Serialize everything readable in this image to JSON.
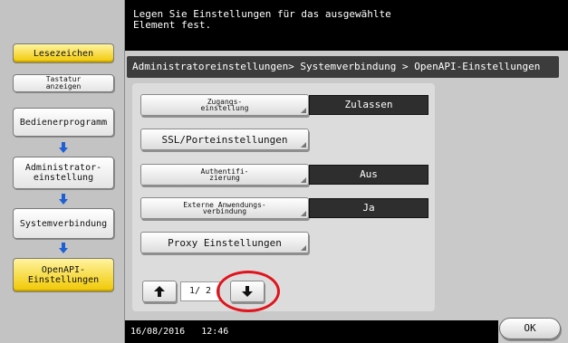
{
  "sidebar": {
    "bookmark_label": "Lesezeichen",
    "keyboard_label": "Tastatur\nanzeigen",
    "items": [
      {
        "label": "Bedienerprogramm"
      },
      {
        "label": "Administrator-\neinstellung"
      },
      {
        "label": "Systemverbindung"
      },
      {
        "label": "OpenAPI-\nEinstellungen"
      }
    ]
  },
  "top_message": "Legen Sie Einstellungen für das ausgewählte\nElement fest.",
  "breadcrumb": "Administratoreinstellungen> Systemverbindung > OpenAPI-Einstellungen",
  "settings": [
    {
      "label": "Zugangs-\neinstellung",
      "value": "Zulassen"
    },
    {
      "label": "SSL/Porteinstellungen",
      "value": ""
    },
    {
      "label": "Authentifi-\nzierung",
      "value": "Aus"
    },
    {
      "label": "Externe Anwendungs-\nverbindung",
      "value": "Ja"
    },
    {
      "label": "Proxy Einstellungen",
      "value": ""
    }
  ],
  "pager": {
    "page": "1/ 2"
  },
  "status": {
    "date": "16/08/2016",
    "time": "12:46"
  },
  "ok_label": "OK",
  "colors": {
    "highlight_circle": "#e0141c",
    "arrow_blue": "#1f5fd6",
    "bookmark_yellow": "#f0c800"
  }
}
